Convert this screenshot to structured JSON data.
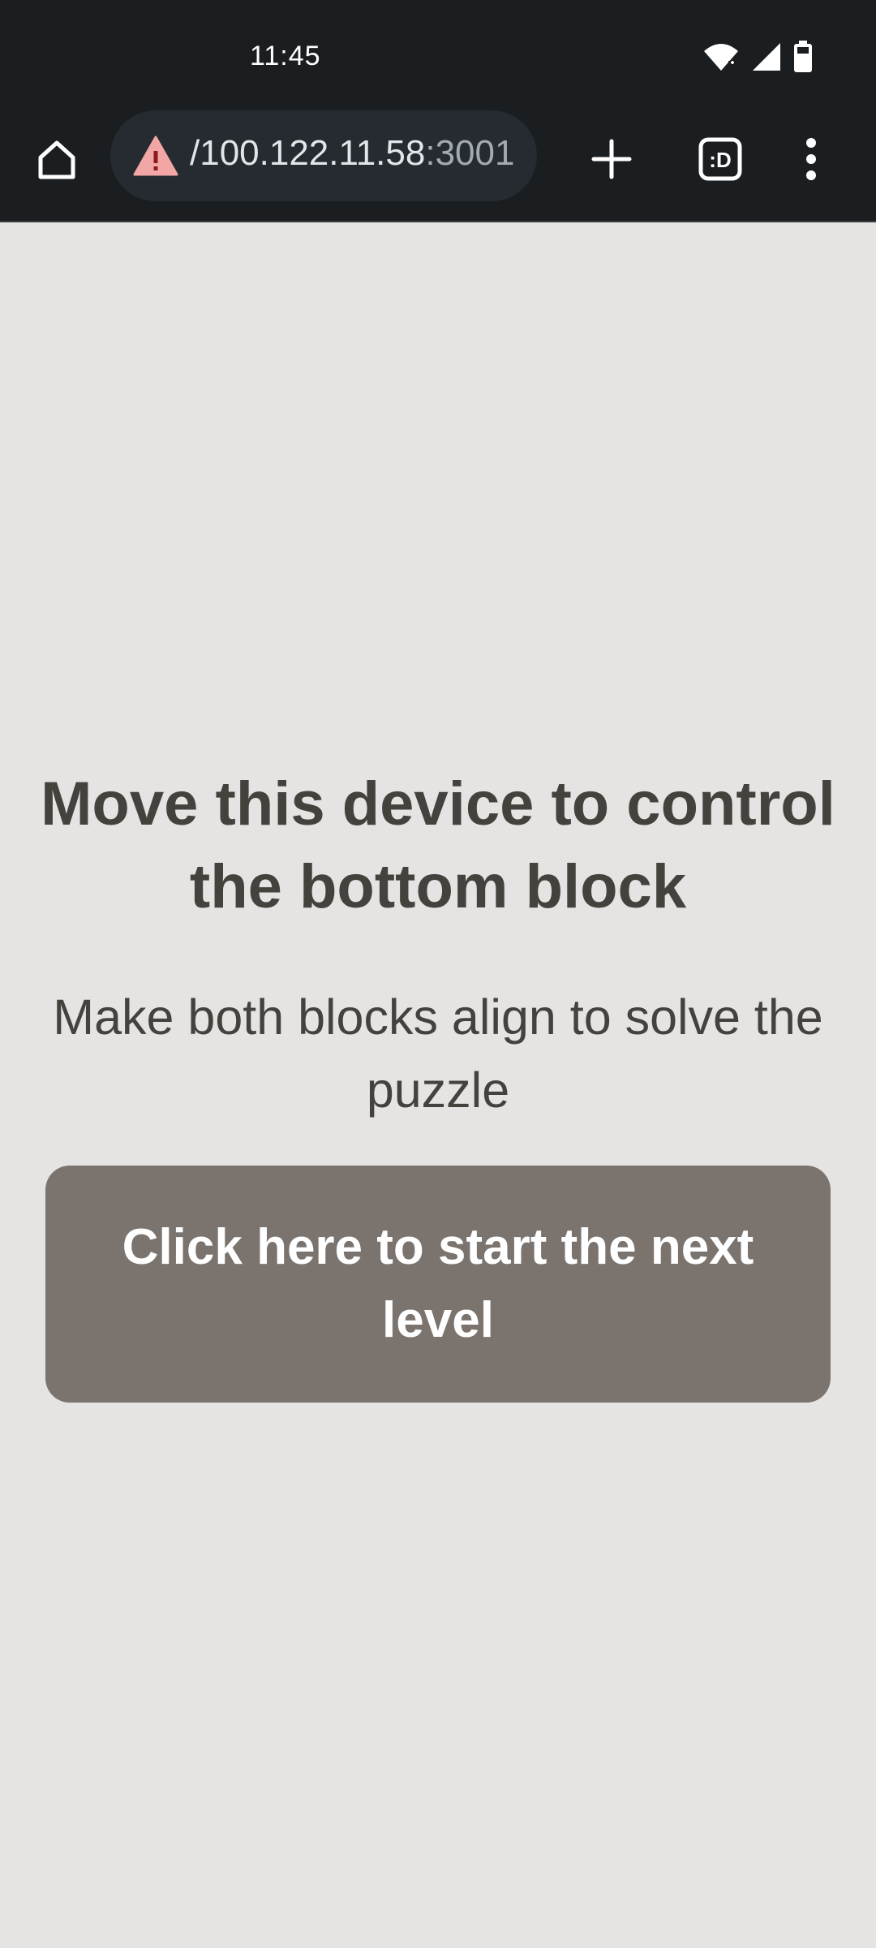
{
  "status_bar": {
    "time": "11:45",
    "icons": [
      "wifi-icon",
      "cellular-signal-icon",
      "battery-icon"
    ]
  },
  "browser": {
    "url_main": "/100.122.11.58",
    "url_port": ":3001",
    "security_icon": "not-secure-warning-icon",
    "toolbar_icons": [
      "home-icon",
      "new-tab-icon",
      "tab-switcher-icon",
      "more-menu-icon"
    ],
    "tab_switcher_label": ":D"
  },
  "page": {
    "headline": "Move this device to control the bottom block",
    "subline": "Make both blocks align to solve the puzzle",
    "start_button_label": "Click here to start the next level"
  },
  "colors": {
    "page_background": "#e5e4e3",
    "text": "#45423e",
    "button_background": "#7b746e",
    "browser_chrome": "#1b1e21",
    "warning_icon": "#f2a6a6"
  }
}
